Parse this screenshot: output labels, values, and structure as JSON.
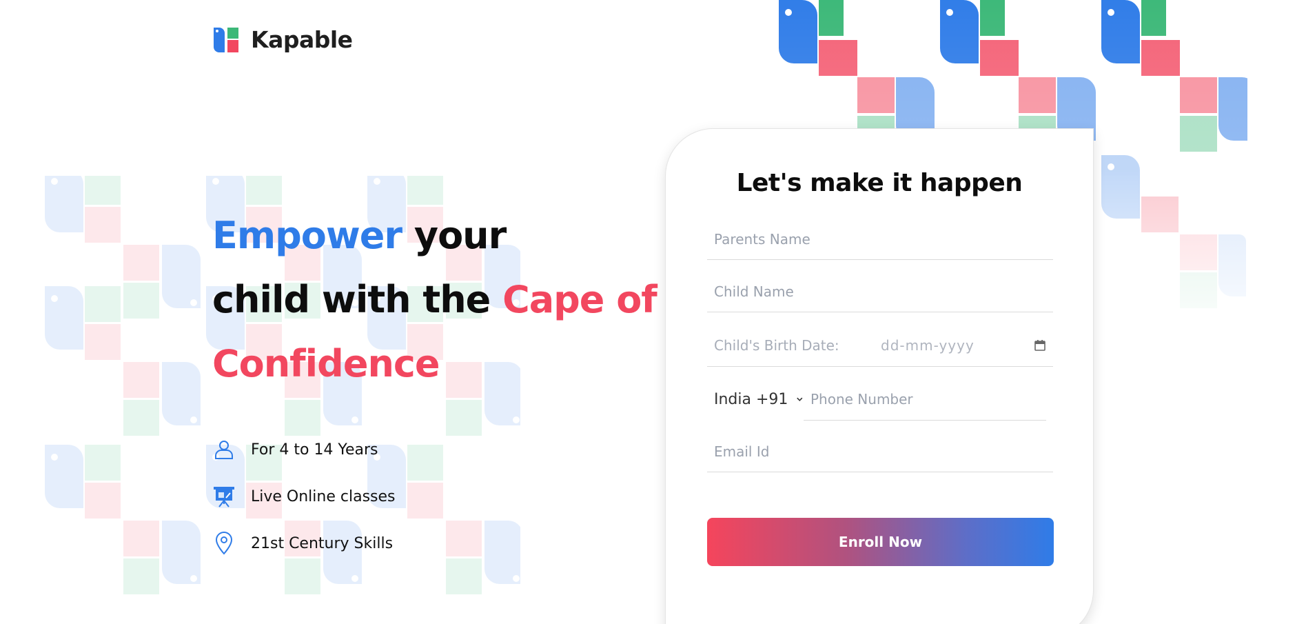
{
  "brand": {
    "name": "Kapable",
    "colors": {
      "blue": "#2f7ce8",
      "red": "#f2475f",
      "green": "#3cb878"
    }
  },
  "hero": {
    "headline_part1": "Empower",
    "headline_part2": " your",
    "headline_part3": "child with the ",
    "headline_part4": "Cape of",
    "headline_part5": "Confidence",
    "features": [
      {
        "icon": "user-icon",
        "label": "For 4 to 14 Years"
      },
      {
        "icon": "presentation-icon",
        "label": "Live Online classes"
      },
      {
        "icon": "location-pin-icon",
        "label": "21st Century Skills"
      }
    ]
  },
  "form": {
    "title": "Let's make it happen",
    "parents_name_placeholder": "Parents Name",
    "child_name_placeholder": "Child Name",
    "birth_date_label": "Child's Birth Date:",
    "birth_date_placeholder": "dd-mm-yyyy",
    "country_code": "India +91",
    "phone_placeholder": "Phone Number",
    "email_placeholder": "Email Id",
    "submit_label": "Enroll Now"
  }
}
